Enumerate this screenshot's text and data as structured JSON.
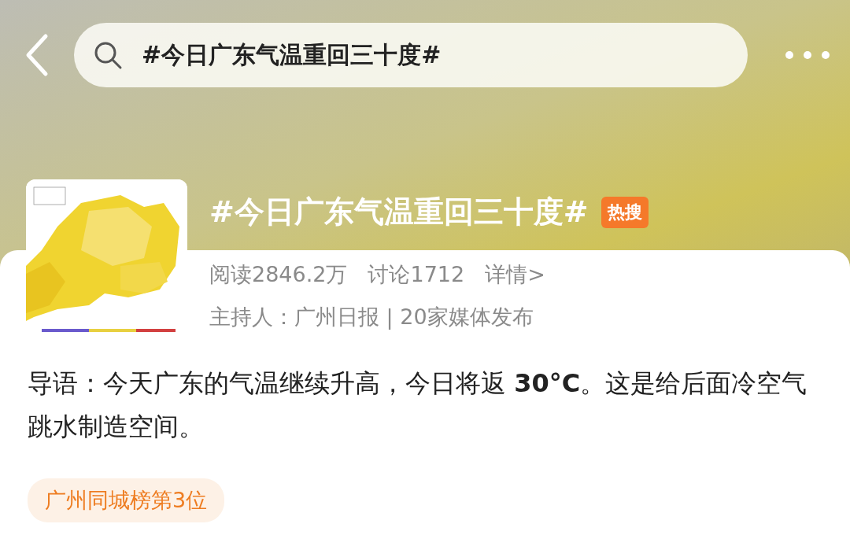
{
  "header": {
    "search": {
      "value": "#今日广东气温重回三十度#"
    }
  },
  "topic": {
    "title": "#今日广东气温重回三十度#",
    "badge": "热搜",
    "stats": [
      "阅读2846.2万",
      "讨论1712"
    ],
    "details_link": "详情>",
    "host": "主持人：广州日报 | 20家媒体发布"
  },
  "intro": "导语：今天广东的气温继续升高，今日将返 **30°C**。这是给后面冷空气跳水制造空间。",
  "tag": "广州同城榜第3位"
}
